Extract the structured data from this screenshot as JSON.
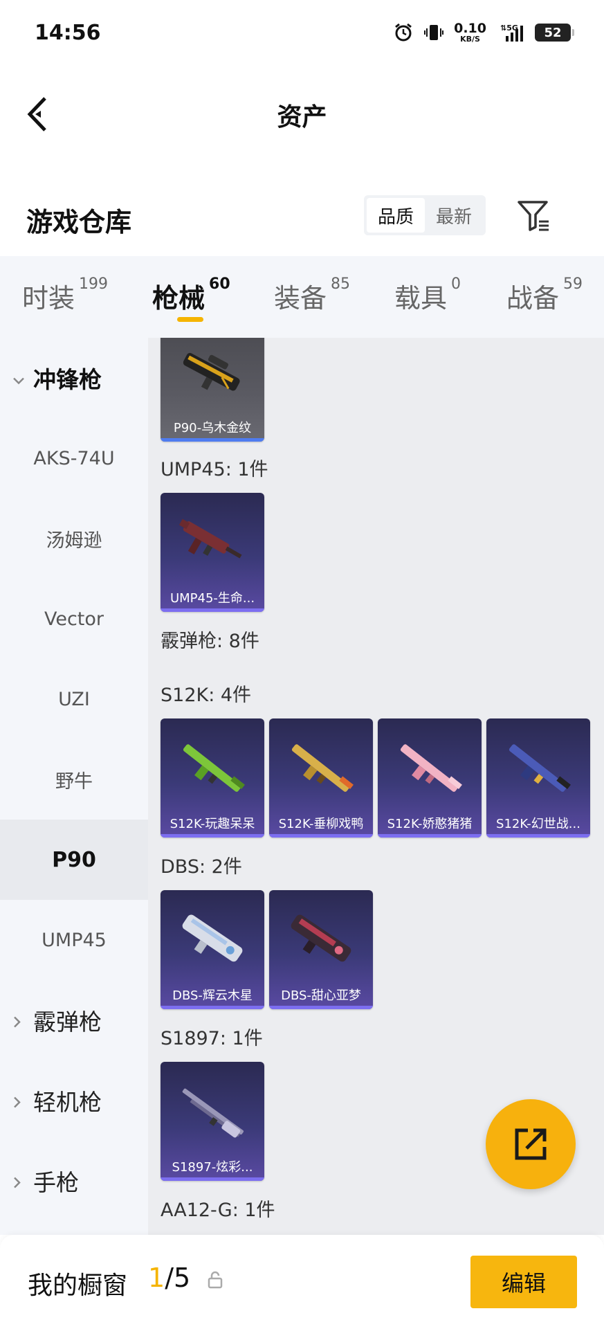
{
  "status_bar": {
    "time": "14:56",
    "net_speed_value": "0.10",
    "net_speed_unit": "KB/S",
    "network": "5G",
    "battery": "52",
    "icons": [
      "alarm-icon",
      "vibrate-icon",
      "network-icon",
      "signal-icon",
      "battery-icon"
    ]
  },
  "header": {
    "title": "资产",
    "back_icon": "back-arrow-icon"
  },
  "warehouse": {
    "title": "游戏仓库",
    "sort_options": [
      "品质",
      "最新"
    ],
    "sort_selected": "品质",
    "filter_icon": "filter-icon"
  },
  "tabs": [
    {
      "label": "时装",
      "count": "199"
    },
    {
      "label": "枪械",
      "count": "60"
    },
    {
      "label": "装备",
      "count": "85"
    },
    {
      "label": "载具",
      "count": "0"
    },
    {
      "label": "战备",
      "count": "59"
    }
  ],
  "active_tab": "枪械",
  "sidebar": {
    "items": [
      {
        "label": "冲锋枪",
        "type": "group",
        "expanded": true
      },
      {
        "label": "AKS-74U",
        "type": "item"
      },
      {
        "label": "汤姆逊",
        "type": "item"
      },
      {
        "label": "Vector",
        "type": "item"
      },
      {
        "label": "UZI",
        "type": "item"
      },
      {
        "label": "野牛",
        "type": "item"
      },
      {
        "label": "P90",
        "type": "item",
        "active": true
      },
      {
        "label": "UMP45",
        "type": "item"
      },
      {
        "label": "霰弹枪",
        "type": "group",
        "expanded": false
      },
      {
        "label": "轻机枪",
        "type": "group",
        "expanded": false
      },
      {
        "label": "手枪",
        "type": "group",
        "expanded": false
      }
    ]
  },
  "content": {
    "sections": [
      {
        "label": "",
        "items": [
          {
            "name": "P90-乌木金纹"
          }
        ]
      },
      {
        "label": "UMP45: 1件",
        "items": [
          {
            "name": "UMP45-生命..."
          }
        ]
      },
      {
        "label": "霰弹枪: 8件",
        "items": []
      },
      {
        "label": "S12K: 4件",
        "items": [
          {
            "name": "S12K-玩趣呆呆"
          },
          {
            "name": "S12K-垂柳戏鸭"
          },
          {
            "name": "S12K-娇憨猪猪"
          },
          {
            "name": "S12K-幻世战..."
          }
        ]
      },
      {
        "label": "DBS: 2件",
        "items": [
          {
            "name": "DBS-辉云木星"
          },
          {
            "name": "DBS-甜心亚梦"
          }
        ]
      },
      {
        "label": "S1897: 1件",
        "items": [
          {
            "name": "S1897-炫彩..."
          }
        ]
      },
      {
        "label": "AA12-G: 1件",
        "items": []
      }
    ],
    "gun_colors": {
      "p90": "#d9a21b",
      "ump45": "#8a3a3a",
      "s12k_1": "#7dc63a",
      "s12k_2": "#d8b04a",
      "s12k_3": "#f2b3c4",
      "s12k_4": "#4b5bb8",
      "dbs_1": "#d8dde8",
      "dbs_2": "#b43d52",
      "s1897": "#9a97b8"
    }
  },
  "fab": {
    "icon": "share-icon"
  },
  "bottom_bar": {
    "label": "我的橱窗",
    "current": "1",
    "total": "/5",
    "lock_icon": "lock-icon",
    "edit_label": "编辑"
  },
  "colors": {
    "accent": "#f7b60e",
    "card_bg": "#3b3a78",
    "sidebar_bg": "#f4f6fa"
  }
}
